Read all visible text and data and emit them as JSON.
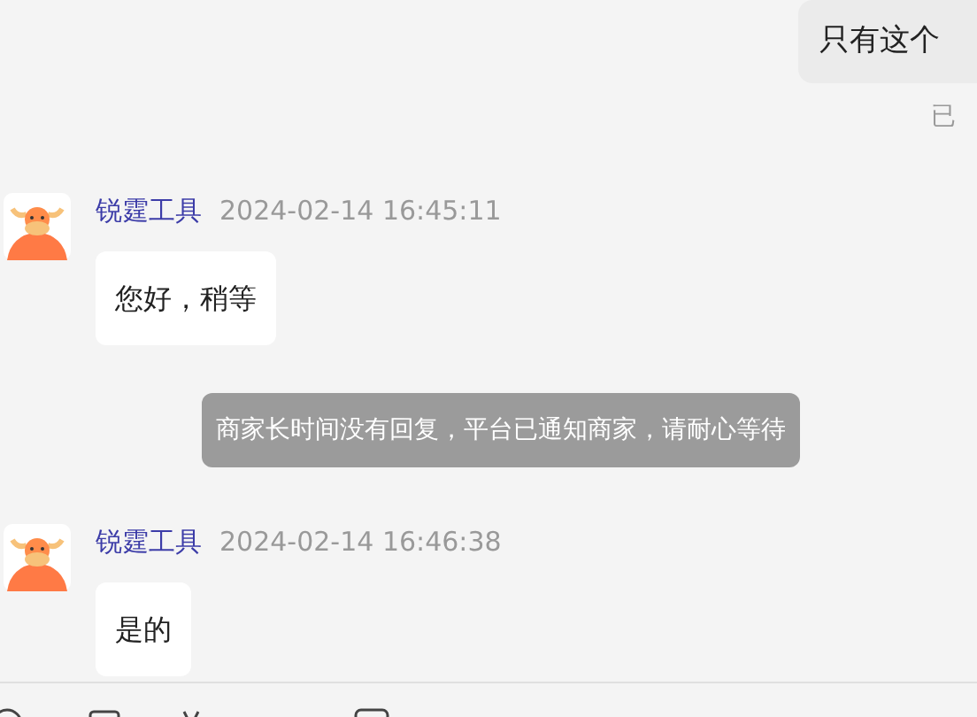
{
  "messages": [
    {
      "kind": "outgoing",
      "text": "只有这个",
      "status": "已"
    },
    {
      "kind": "incoming",
      "sender": "锐霆工具",
      "time": "2024-02-14 16:45:11",
      "text": "您好，稍等"
    },
    {
      "kind": "system",
      "text": "商家长时间没有回复，平台已通知商家，请耐心等待"
    },
    {
      "kind": "incoming",
      "sender": "锐霆工具",
      "time": "2024-02-14 16:46:38",
      "text": "是的"
    }
  ]
}
